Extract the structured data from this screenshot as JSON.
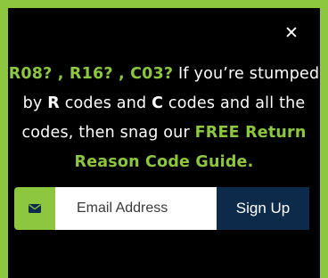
{
  "popup": {
    "close_label": "✕",
    "message": {
      "code_1": "R08?",
      "sep_1": " , ",
      "code_2": "R16?",
      "sep_2": " , ",
      "code_3": "C03?",
      "text_1": " If you’re stumped by ",
      "letter_r": "R",
      "text_2": " codes and ",
      "letter_c": "C",
      "text_3": " codes and all the codes, then snag our ",
      "guide_link": "FREE Return Reason Code Guide."
    },
    "form": {
      "icon": "envelope-icon",
      "email_placeholder": "Email Address",
      "email_value": "",
      "signup_label": "Sign Up"
    }
  },
  "colors": {
    "accent": "#8dc63f",
    "background": "#000000",
    "button": "#0d2a4a",
    "text": "#ffffff"
  }
}
